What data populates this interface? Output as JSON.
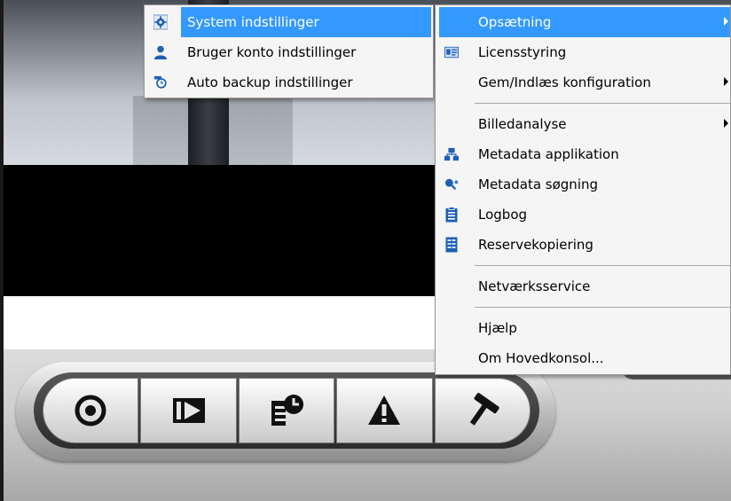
{
  "submenu": {
    "items": [
      {
        "label": "System indstillinger",
        "icon": "gear-icon",
        "selected": true
      },
      {
        "label": "Bruger konto indstillinger",
        "icon": "user-icon"
      },
      {
        "label": "Auto backup indstillinger",
        "icon": "backup-clock-icon"
      }
    ]
  },
  "main_menu": {
    "items": [
      {
        "label": "Opsætning",
        "selected": true,
        "has_submenu": true
      },
      {
        "label": "Licensstyring",
        "icon": "license-card-icon"
      },
      {
        "label": "Gem/Indlæs konfiguration",
        "has_submenu": true
      },
      {
        "label": "Billedanalyse",
        "has_submenu": true
      },
      {
        "label": "Metadata applikation",
        "icon": "network-app-icon"
      },
      {
        "label": "Metadata søgning",
        "icon": "search-people-icon"
      },
      {
        "label": "Logbog",
        "icon": "clipboard-icon"
      },
      {
        "label": "Reservekopiering",
        "icon": "backup-list-icon"
      },
      {
        "label": "Netværksservice"
      },
      {
        "label": "Hjælp"
      },
      {
        "label": "Om Hovedkonsol..."
      }
    ]
  },
  "toolbar": {
    "buttons": [
      {
        "name": "record",
        "icon": "record-icon"
      },
      {
        "name": "playback",
        "icon": "playback-icon"
      },
      {
        "name": "schedule",
        "icon": "schedule-icon"
      },
      {
        "name": "alert",
        "icon": "warning-icon"
      },
      {
        "name": "tools",
        "icon": "hammer-icon"
      }
    ]
  },
  "colors": {
    "selection": "#3399ff",
    "menu_bg": "#f5f5f5",
    "icon_blue": "#1f5fb4"
  }
}
